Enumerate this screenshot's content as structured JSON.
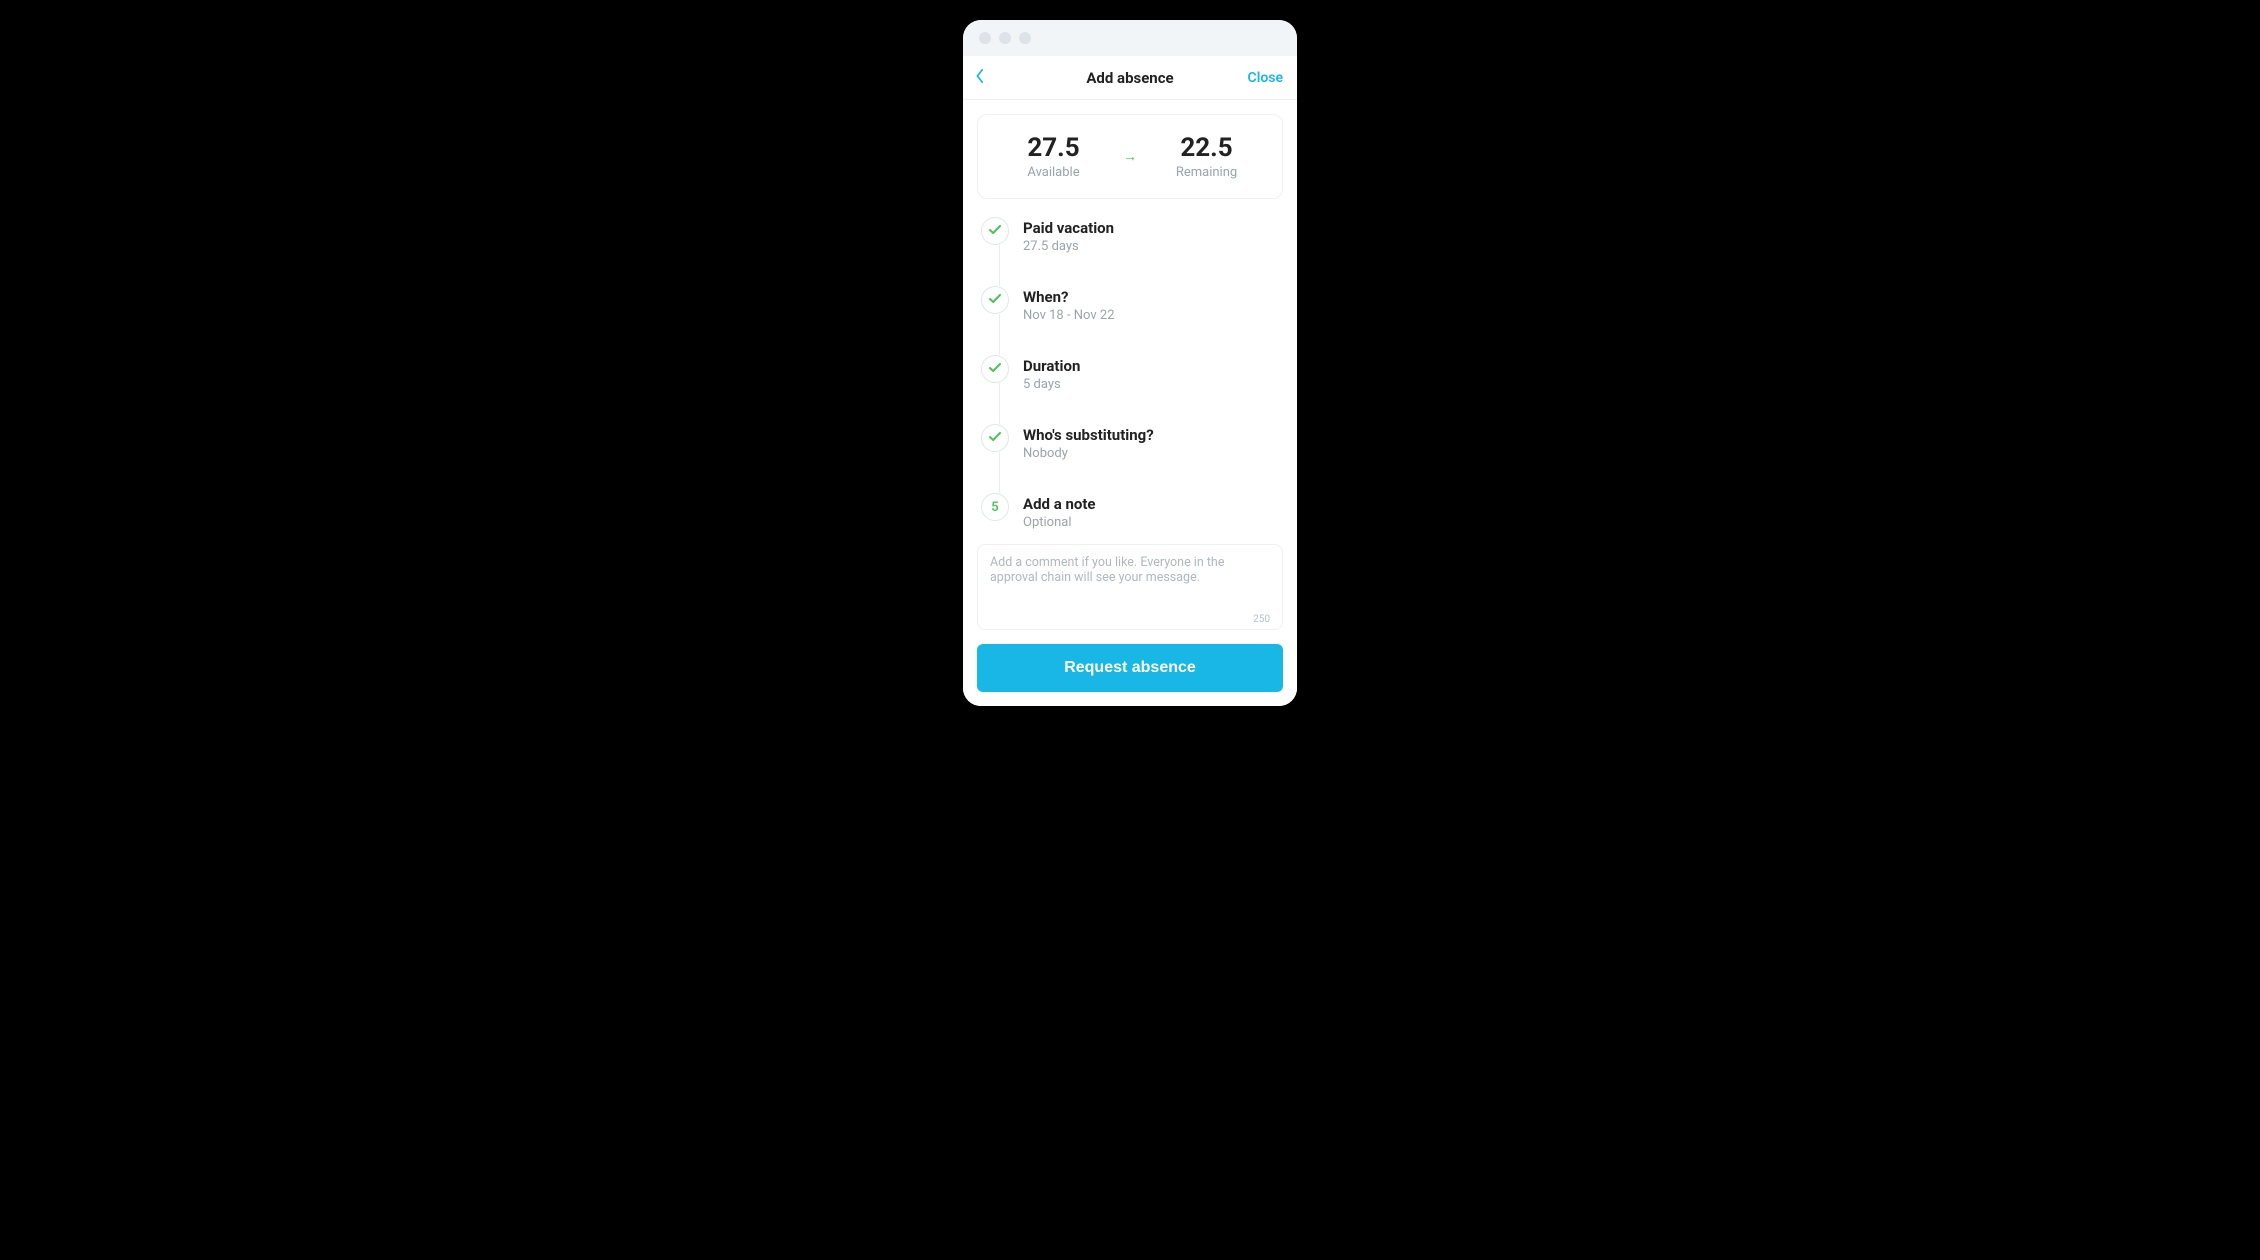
{
  "header": {
    "title": "Add absence",
    "close_label": "Close"
  },
  "balance": {
    "available_value": "27.5",
    "available_label": "Available",
    "remaining_value": "22.5",
    "remaining_label": "Remaining"
  },
  "steps": [
    {
      "title": "Paid vacation",
      "subtitle": "27.5 days",
      "completed": true
    },
    {
      "title": "When?",
      "subtitle": "Nov 18 - Nov 22",
      "completed": true
    },
    {
      "title": "Duration",
      "subtitle": "5 days",
      "completed": true
    },
    {
      "title": "Who's substituting?",
      "subtitle": "Nobody",
      "completed": true
    },
    {
      "title": "Add a note",
      "subtitle": "Optional",
      "number": "5",
      "completed": false
    }
  ],
  "note": {
    "placeholder": "Add a comment if you like. Everyone in the approval chain will see your message.",
    "char_limit": "250"
  },
  "footer": {
    "request_label": "Request absence"
  },
  "colors": {
    "accent": "#19b7e6",
    "success": "#4cc35a"
  }
}
